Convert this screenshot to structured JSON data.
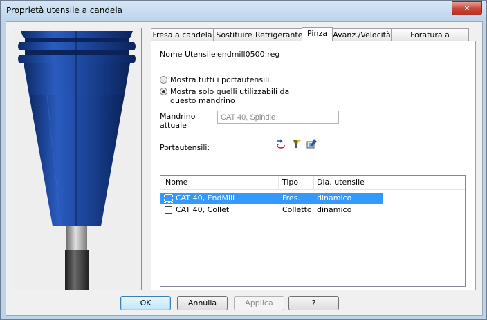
{
  "window": {
    "title": "Proprietà utensile a candela",
    "close_label": "✕"
  },
  "tabs": [
    {
      "label": "Fresa a candela",
      "active": false
    },
    {
      "label": "Sostituire",
      "active": false
    },
    {
      "label": "Refrigerante",
      "active": false
    },
    {
      "label": "Pinza",
      "active": true
    },
    {
      "label": "Avanz./Velocità",
      "active": false
    },
    {
      "label": "Foratura a incrementi",
      "active": false
    }
  ],
  "pinza": {
    "tool_name_label": "Nome Utensile:",
    "tool_name_value": "endmill0500:reg",
    "radio_all_label": "Mostra tutti i portautensili",
    "radio_spindle_label": "Mostra solo quelli utilizzabili da questo mandrino",
    "selected_radio": "spindle",
    "spindle_label": "Mandrino attuale",
    "spindle_value": "CAT 40, Spindle",
    "holders_label": "Portautensili:",
    "toolbar_icons": [
      "refresh-icon",
      "new-holder-icon",
      "edit-holder-icon"
    ],
    "list": {
      "columns": [
        "Nome",
        "Tipo",
        "Dia. utensile"
      ],
      "rows": [
        {
          "name": "CAT 40, EndMill",
          "type": "Fres.",
          "dia": "dinamico",
          "selected": true,
          "checked": false
        },
        {
          "name": "CAT 40, Collet",
          "type": "Colletto",
          "dia": "dinamico",
          "selected": false,
          "checked": false
        }
      ]
    }
  },
  "buttons": {
    "ok": "OK",
    "cancel": "Annulla",
    "apply": "Applica",
    "help": "?"
  },
  "colors": {
    "tool_body": "#1f4aa0",
    "selection": "#3399ff"
  }
}
